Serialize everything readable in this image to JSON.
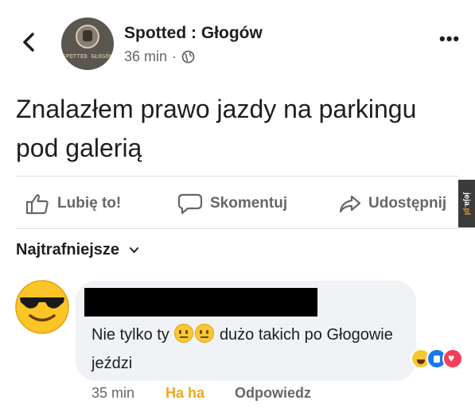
{
  "header": {
    "page_name": "Spotted : Głogów",
    "time": "36 min",
    "separator": "·",
    "avatar_logo_text": "SPOTTED GŁOGÓW"
  },
  "post": {
    "text": "Znalazłem prawo jazdy na parkingu pod galerią"
  },
  "actions": {
    "like": "Lubię to!",
    "comment": "Skomentuj",
    "share": "Udostępnij"
  },
  "watermark": {
    "prefix": "jeja",
    "suffix": ".pl"
  },
  "comments_sort": "Najtrafniejsze",
  "comment": {
    "text_before": "Nie tylko ty",
    "text_after": "dużo takich po Głogowie jeździ",
    "time": "35 min",
    "reaction_label": "Ha ha",
    "reply_label": "Odpowiedz",
    "reactions": [
      "haha",
      "like",
      "love"
    ]
  },
  "colors": {
    "brand_blue": "#1877f2",
    "secondary_text": "#65676b",
    "haha_orange": "#f0a81c",
    "bubble_bg": "#f0f2f5"
  }
}
